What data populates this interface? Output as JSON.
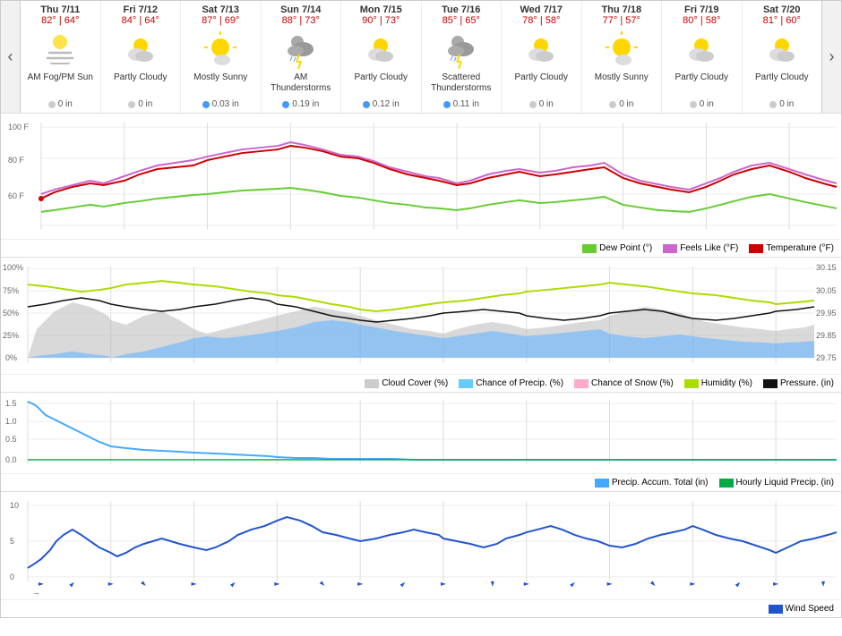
{
  "nav": {
    "left_arrow": "‹",
    "right_arrow": "›"
  },
  "days": [
    {
      "name": "Thu 7/11",
      "high": "82°",
      "low": "64°",
      "desc": "AM Fog/PM Sun",
      "precip": "0 in",
      "precip_type": "none",
      "icon_type": "fog_sun"
    },
    {
      "name": "Fri 7/12",
      "high": "84°",
      "low": "64°",
      "desc": "Partly Cloudy",
      "precip": "0 in",
      "precip_type": "none",
      "icon_type": "partly_cloudy"
    },
    {
      "name": "Sat 7/13",
      "high": "87°",
      "low": "69°",
      "desc": "Mostly Sunny",
      "precip": "0.03 in",
      "precip_type": "rain",
      "icon_type": "mostly_sunny"
    },
    {
      "name": "Sun 7/14",
      "high": "88°",
      "low": "73°",
      "desc": "AM Thunderstorms",
      "precip": "0.19 in",
      "precip_type": "rain",
      "icon_type": "thunderstorm"
    },
    {
      "name": "Mon 7/15",
      "high": "90°",
      "low": "73°",
      "desc": "Partly Cloudy",
      "precip": "0.12 in",
      "precip_type": "rain",
      "icon_type": "partly_cloudy"
    },
    {
      "name": "Tue 7/16",
      "high": "85°",
      "low": "65°",
      "desc": "Scattered Thunderstorms",
      "precip": "0.11 in",
      "precip_type": "rain",
      "icon_type": "scattered_thunder"
    },
    {
      "name": "Wed 7/17",
      "high": "78°",
      "low": "58°",
      "desc": "Partly Cloudy",
      "precip": "0 in",
      "precip_type": "none",
      "icon_type": "partly_cloudy"
    },
    {
      "name": "Thu 7/18",
      "high": "77°",
      "low": "57°",
      "desc": "Mostly Sunny",
      "precip": "0 in",
      "precip_type": "none",
      "icon_type": "mostly_sunny"
    },
    {
      "name": "Fri 7/19",
      "high": "80°",
      "low": "58°",
      "desc": "Partly Cloudy",
      "precip": "0 in",
      "precip_type": "none",
      "icon_type": "partly_cloudy"
    },
    {
      "name": "Sat 7/20",
      "high": "81°",
      "low": "60°",
      "desc": "Partly Cloudy",
      "precip": "0 in",
      "precip_type": "none",
      "icon_type": "partly_cloudy"
    }
  ],
  "chart1_legend": [
    {
      "color": "#66cc33",
      "label": "Dew Point (°)"
    },
    {
      "color": "#cc66cc",
      "label": "Feels Like (°F)"
    },
    {
      "color": "#cc0000",
      "label": "Temperature (°F)"
    }
  ],
  "chart2_legend": [
    {
      "color": "#cccccc",
      "label": "Cloud Cover (%)"
    },
    {
      "color": "#66ccff",
      "label": "Chance of Precip. (%)"
    },
    {
      "color": "#ffaacc",
      "label": "Chance of Snow (%)"
    },
    {
      "color": "#aadd00",
      "label": "Humidity (%)"
    },
    {
      "color": "#111111",
      "label": "Pressure. (in)"
    }
  ],
  "chart3_legend": [
    {
      "color": "#44aaff",
      "label": "Precip. Accum. Total (in)"
    },
    {
      "color": "#00aa44",
      "label": "Hourly Liquid Precip. (in)"
    }
  ],
  "chart4_legend": [
    {
      "color": "#2255cc",
      "label": "Wind Speed"
    }
  ],
  "chart1_y_labels": [
    "100 F",
    "80 F",
    "60 F"
  ],
  "chart2_y_labels": [
    "100%",
    "75%",
    "50%",
    "25%",
    "0%"
  ],
  "chart2_y_right": [
    "30.15",
    "30.05",
    "29.95",
    "29.85",
    "29.75"
  ],
  "chart3_y_labels": [
    "1.5",
    "1.0",
    "0.5",
    "0.0"
  ],
  "chart4_y_labels": [
    "10",
    "5",
    "0"
  ]
}
